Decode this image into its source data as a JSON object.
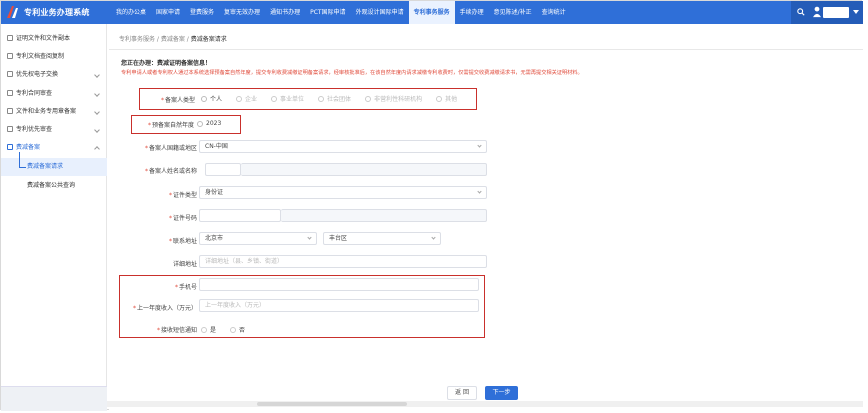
{
  "app": {
    "title": "专利业务办理系统"
  },
  "nav": {
    "items": [
      "我的办公桌",
      "国家申请",
      "登费服务",
      "复审无效办理",
      "通知书办理",
      "PCT国际申请",
      "外观设计国际申请",
      "专利事务服务",
      "手续办理",
      "意见陈述/补正",
      "查询统计"
    ],
    "active_index": 7
  },
  "sidebar": {
    "items": [
      {
        "label": "证明文件和文件副本"
      },
      {
        "label": "专利文档查阅复制"
      },
      {
        "label": "优先权电子交换"
      },
      {
        "label": "专利合同审查"
      },
      {
        "label": "文件和业务专用章备案"
      },
      {
        "label": "专利优先审查"
      },
      {
        "label": "费减备案"
      }
    ],
    "subitems": [
      {
        "label": "费减备案请求",
        "active": true
      },
      {
        "label": "费减备案公共查询",
        "active": false
      }
    ]
  },
  "breadcrumb": {
    "items": [
      "专利事务服务",
      "费减备案"
    ],
    "current": "费减备案请求"
  },
  "notice": {
    "title": "您正在办理：费减证明备案信息！",
    "text": "专利申请人或者专利权人通过本系统选择预备案自然年度，提交专利收费减缴证明备案请求，经审核批准后，在该自然年度内请求减缴专利收费时，仅需提交收费减缴请求书，无需再提交相关证明材料。"
  },
  "form": {
    "applicant_type": {
      "label": "备案人类型",
      "options": [
        "个人",
        "企业",
        "事业单位",
        "社会团体",
        "非营利性科研机构",
        "其他"
      ],
      "selected": "个人"
    },
    "year": {
      "label": "预备案自然年度",
      "value": "2023"
    },
    "region": {
      "label": "备案人国籍或地区",
      "value": "CN-中国"
    },
    "name": {
      "label": "备案人姓名或名称",
      "value": ""
    },
    "id_type": {
      "label": "证件类型",
      "value": "身份证"
    },
    "id_number": {
      "label": "证件号码",
      "value": ""
    },
    "address": {
      "label": "联系地址",
      "province": "北京市",
      "district": "丰台区"
    },
    "detail_address": {
      "label": "详细地址",
      "placeholder": "详细地址（县、乡镇、街道）"
    },
    "phone": {
      "label": "手机号",
      "value": ""
    },
    "income": {
      "label": "上一年度收入（万元）",
      "placeholder": "上一年度收入（万元）"
    },
    "sms": {
      "label": "接收短信通知",
      "options": [
        "是",
        "否"
      ],
      "selected": ""
    }
  },
  "buttons": {
    "back": "返 回",
    "next": "下一步"
  },
  "colors": {
    "nav_bg": "#2f6fd8",
    "highlight_border": "#c9302c",
    "required": "#e04a3a"
  }
}
